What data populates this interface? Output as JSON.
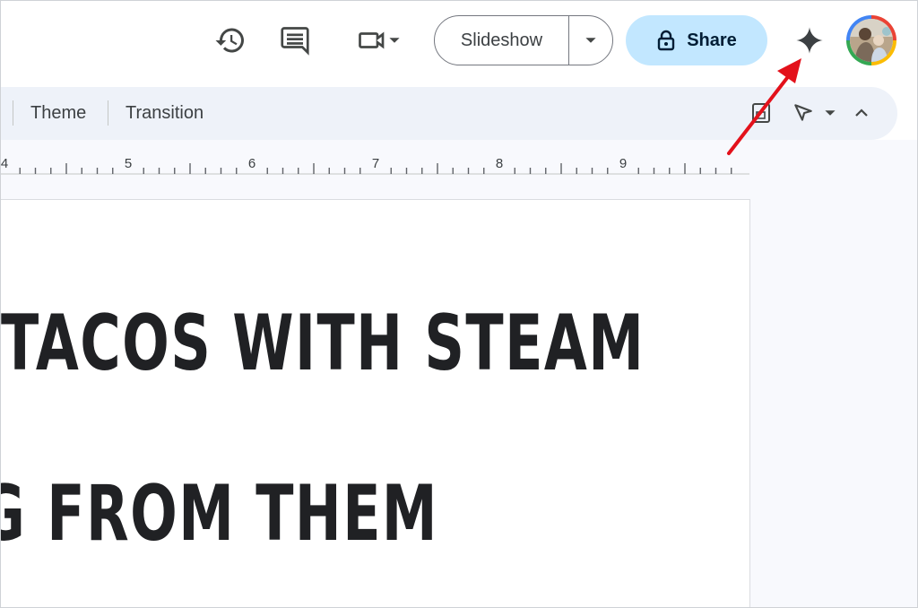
{
  "topbar": {
    "history_icon": "version-history-icon",
    "comments_icon": "comments-icon",
    "meet_icon": "video-call-icon",
    "slideshow_label": "Slideshow",
    "share_label": "Share",
    "gemini_icon": "gemini-sparkle-icon",
    "avatar": "account-avatar"
  },
  "toolbar": {
    "items": [
      {
        "label": "Theme"
      },
      {
        "label": "Transition"
      }
    ],
    "right_icons": [
      "add-comment-icon",
      "select-pointer-icon",
      "chevron-down-icon",
      "chevron-up-icon"
    ]
  },
  "ruler": {
    "labels": [
      "4",
      "5",
      "6",
      "7",
      "8",
      "9"
    ]
  },
  "slide": {
    "lines": [
      "TACOS WITH STEAM",
      "G FROM THEM"
    ]
  },
  "annotation": {
    "arrow_color": "#e3111b"
  },
  "colors": {
    "share_bg": "#c2e7ff",
    "toolbar_bg": "#eef2f9",
    "workspace_bg": "#f8f9fd"
  }
}
